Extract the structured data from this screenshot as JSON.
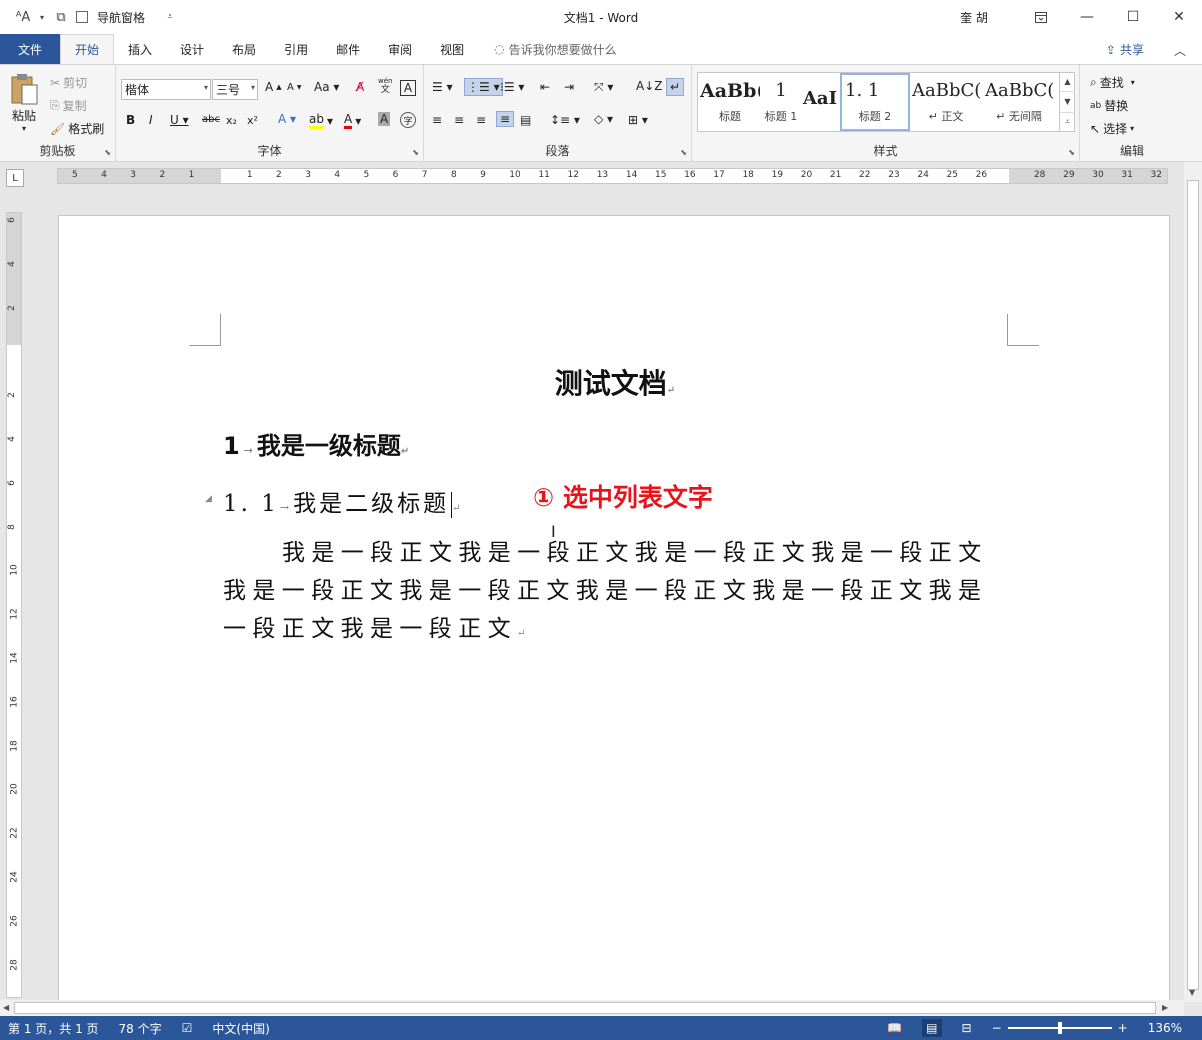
{
  "qat": {
    "nav_pane_label": "导航窗格"
  },
  "window": {
    "title": "文档1  -  Word",
    "user": "奎 胡",
    "ribbon_display_icon": "ribbon-display-icon",
    "minimize": "—",
    "maximize": "☐",
    "close": "✕"
  },
  "tabs": [
    "文件",
    "开始",
    "插入",
    "设计",
    "布局",
    "引用",
    "邮件",
    "审阅",
    "视图"
  ],
  "tell_me": "告诉我你想要做什么",
  "share": "共享",
  "ribbon": {
    "clipboard": {
      "label": "剪贴板",
      "paste": "粘贴",
      "cut": "剪切",
      "copy": "复制",
      "format_painter": "格式刷"
    },
    "font": {
      "label": "字体",
      "font_name": "楷体",
      "font_size": "三号"
    },
    "paragraph": {
      "label": "段落"
    },
    "styles": {
      "label": "样式",
      "items": [
        {
          "preview": "AaBb(",
          "name": "标题"
        },
        {
          "preview": "1",
          "name": "标题 1"
        },
        {
          "preview": "AaI",
          "name": ""
        },
        {
          "preview": "1. 1",
          "name": "标题 2"
        },
        {
          "preview": "AaBbC(",
          "name": "↵ 正文"
        },
        {
          "preview": "AaBbC(",
          "name": "↵ 无间隔"
        }
      ]
    },
    "editing": {
      "label": "编辑",
      "find": "查找",
      "replace": "替换",
      "select": "选择"
    }
  },
  "ruler": {
    "h_numbers": [
      "5",
      "4",
      "3",
      "2",
      "1",
      "",
      "1",
      "2",
      "3",
      "4",
      "5",
      "6",
      "7",
      "8",
      "9",
      "10",
      "11",
      "12",
      "13",
      "14",
      "15",
      "16",
      "17",
      "18",
      "19",
      "20",
      "21",
      "22",
      "23",
      "24",
      "25",
      "26",
      "",
      "28",
      "29",
      "30",
      "31",
      "32"
    ],
    "v_numbers": [
      "6",
      "4",
      "2",
      "",
      "2",
      "4",
      "6",
      "8",
      "10",
      "12",
      "14",
      "16",
      "18",
      "20",
      "22",
      "24",
      "26",
      "28"
    ]
  },
  "document": {
    "title": "测试文档",
    "h1_num": "1",
    "h1_text": "我是一级标题",
    "h2_num": "1. 1",
    "h2_text": "我是二级标题",
    "paragraph": "我是一段正文我是一段正文我是一段正文我是一段正文我是一段正文我是一段正文我是一段正文我是一段正文我是一段正文我是一段正文",
    "annotation": "① 选中列表文字"
  },
  "status": {
    "page": "第 1 页，共 1 页",
    "words": "78 个字",
    "language": "中文(中国)",
    "zoom": "136%",
    "zoom_fraction": 0.5
  }
}
